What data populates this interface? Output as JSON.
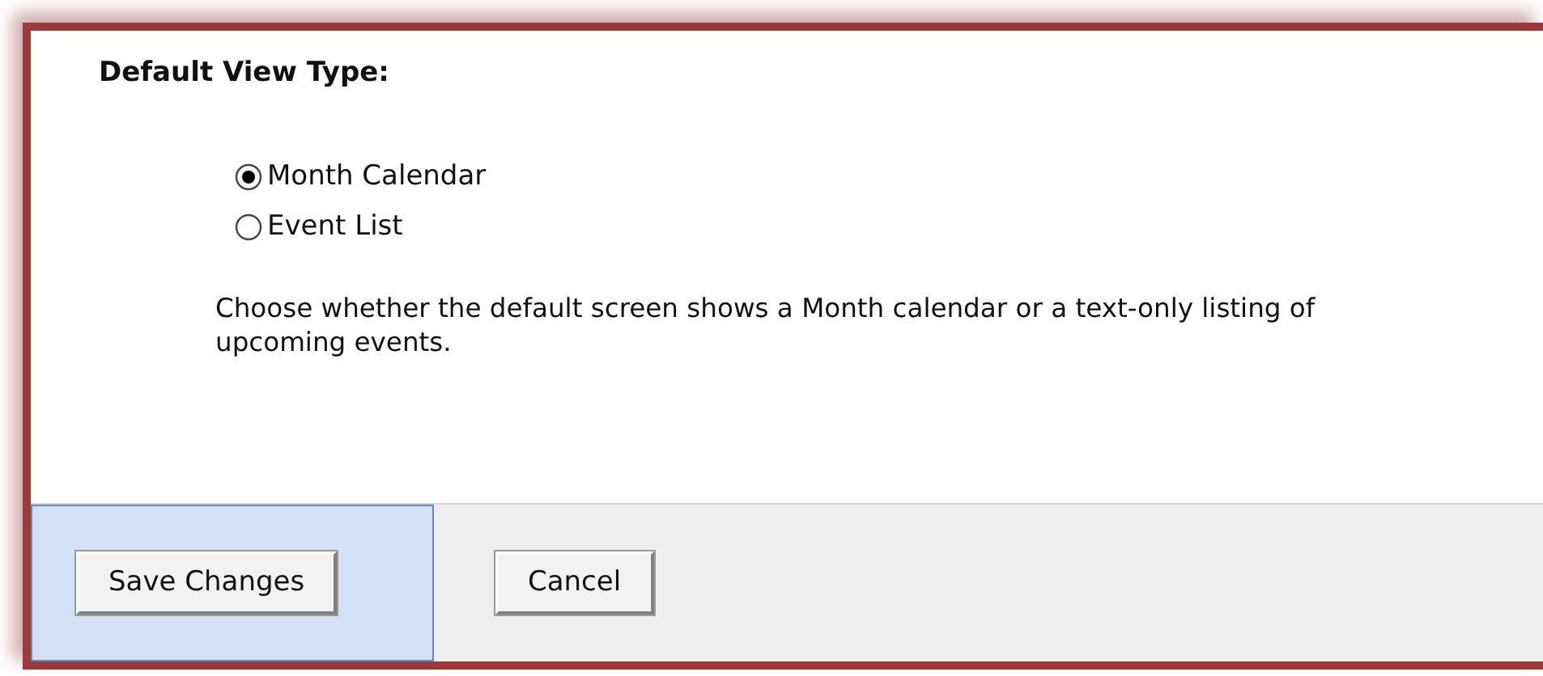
{
  "heading": "Default View Type:",
  "options": [
    {
      "label": "Month Calendar",
      "selected": true
    },
    {
      "label": "Event List",
      "selected": false
    }
  ],
  "description": "Choose whether the default screen shows a Month calendar or a text-only listing of upcoming events.",
  "buttons": [
    {
      "label": "Save Changes",
      "highlighted": true
    },
    {
      "label": "Cancel",
      "highlighted": false
    }
  ]
}
